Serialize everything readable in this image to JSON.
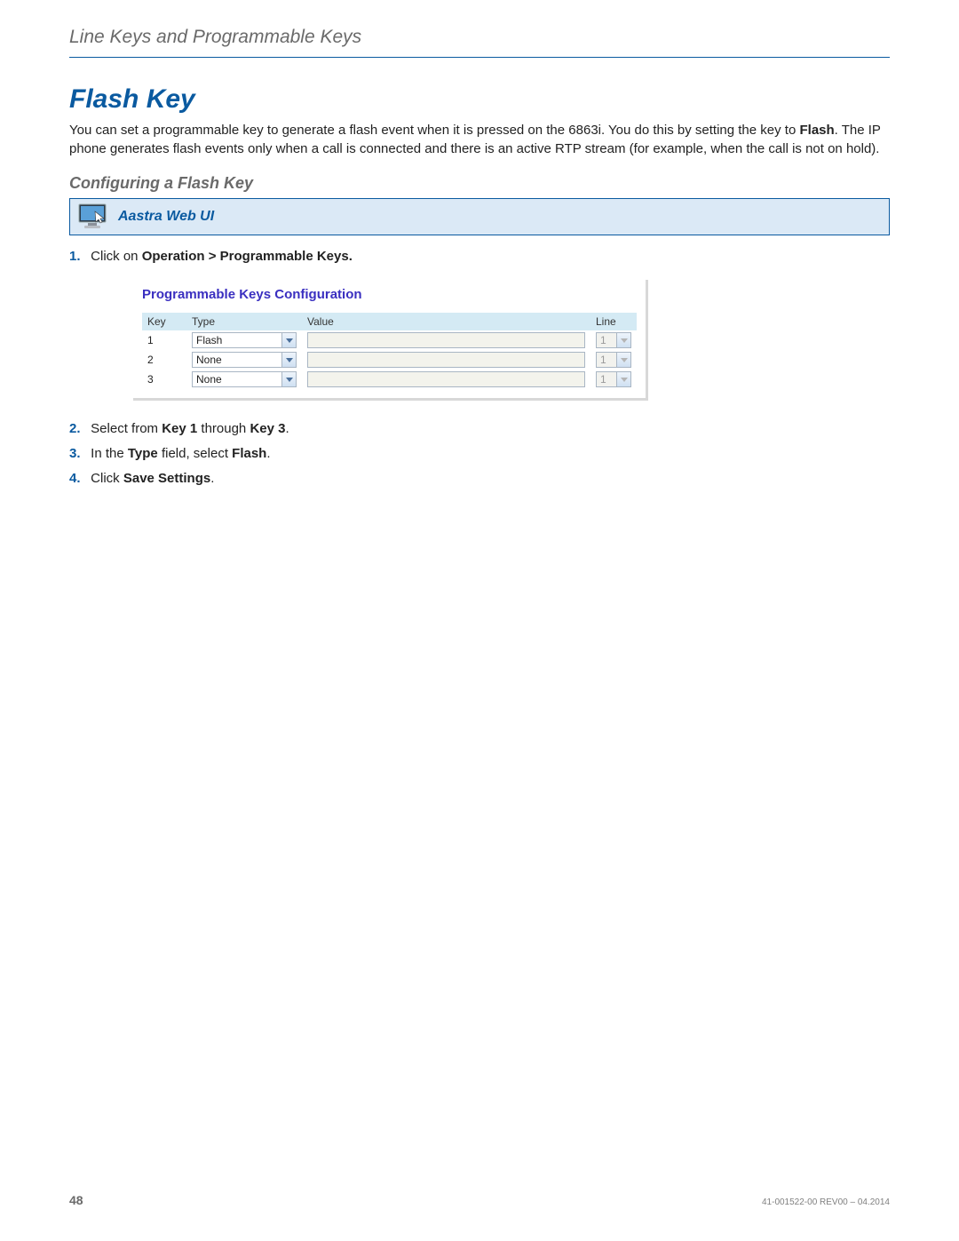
{
  "header": {
    "breadcrumb": "Line Keys and Programmable Keys"
  },
  "main": {
    "title": "Flash Key",
    "intro_pre": "You can set a programmable key to generate a flash event when it is pressed on the 6863i. You do this by setting the key to ",
    "intro_bold": "Flash",
    "intro_post": ". The IP phone generates flash events only when a call is connected and there is an active RTP stream (for example, when the call is not on hold).",
    "subsection": "Configuring a Flash Key",
    "web_ui_label": "Aastra Web UI"
  },
  "steps": [
    {
      "num": "1.",
      "pre": "Click on ",
      "b1": "Operation > Programmable Keys.",
      "mid": "",
      "b2": "",
      "post": ""
    },
    {
      "num": "2.",
      "pre": "Select from ",
      "b1": "Key 1",
      "mid": " through ",
      "b2": "Key 3",
      "post": "."
    },
    {
      "num": "3.",
      "pre": "In the ",
      "b1": "Type",
      "mid": " field, select ",
      "b2": "Flash",
      "post": "."
    },
    {
      "num": "4.",
      "pre": "Click ",
      "b1": "Save Settings",
      "mid": "",
      "b2": "",
      "post": "."
    }
  ],
  "config": {
    "title": "Programmable Keys Configuration",
    "headers": {
      "key": "Key",
      "type": "Type",
      "value": "Value",
      "line": "Line"
    },
    "rows": [
      {
        "key": "1",
        "type": "Flash",
        "value": "",
        "line": "1"
      },
      {
        "key": "2",
        "type": "None",
        "value": "",
        "line": "1"
      },
      {
        "key": "3",
        "type": "None",
        "value": "",
        "line": "1"
      }
    ]
  },
  "footer": {
    "page": "48",
    "docid": "41-001522-00 REV00 – 04.2014"
  }
}
